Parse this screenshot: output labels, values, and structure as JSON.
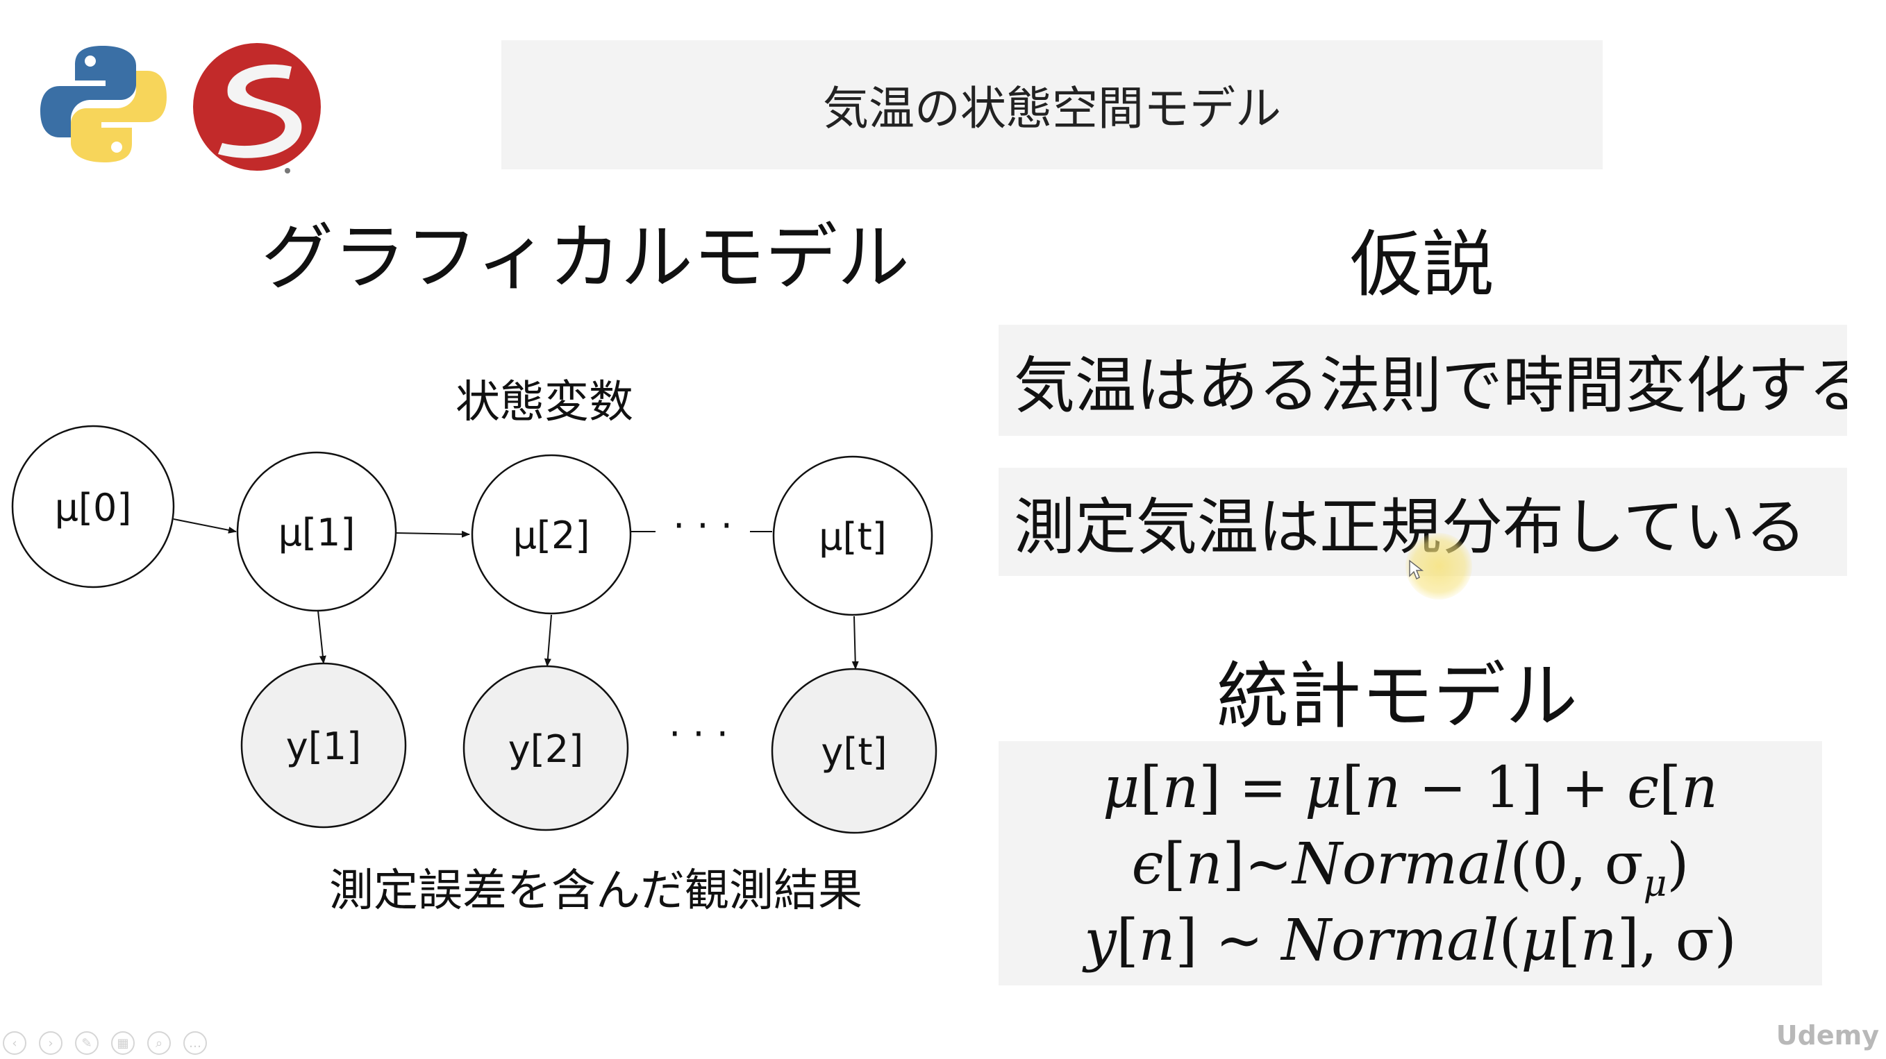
{
  "slide": {
    "title": "気温の状態空間モデル",
    "graphical_heading": "グラフィカルモデル",
    "hypothesis_heading": "仮説",
    "hypotheses": [
      "気温はある法則で時間変化する",
      "測定気温は正規分布している"
    ],
    "stat_heading": "統計モデル",
    "state_label": "状態変数",
    "observation_label": "測定誤差を含んだ観測結果",
    "equations": {
      "eq1": [
        "μ",
        "[",
        "n",
        "] = ",
        "μ",
        "[",
        "n",
        " − 1] +  ",
        "ϵ",
        "[",
        "n",
        "]"
      ],
      "eq2": [
        "ϵ",
        "[",
        "n",
        "]~",
        "Normal",
        "(0, σ",
        "μ",
        ")"
      ],
      "eq3": [
        "y",
        "[",
        "n",
        "] ~ ",
        "Normal",
        "(",
        "μ",
        "[",
        "n",
        "], σ)"
      ]
    }
  },
  "nodes": {
    "mu0": "μ[0]",
    "mu1": "μ[1]",
    "mu2": "μ[2]",
    "mut": "μ[t]",
    "y1": "y[1]",
    "y2": "y[2]",
    "yt": "y[t]",
    "dots_top": "· · ·",
    "dots_bottom": "· · ·"
  },
  "watermark": "Udemy",
  "colors": {
    "python_blue": "#3a6fa5",
    "python_yellow": "#f7d55a",
    "stan_red": "#c22a2a",
    "box_gray": "#f3f3f3",
    "obs_fill": "#f0f0f0",
    "cursor_highlight": "#f6e27a"
  },
  "icons": [
    "python-logo-icon",
    "stan-logo-icon",
    "cursor-icon"
  ]
}
